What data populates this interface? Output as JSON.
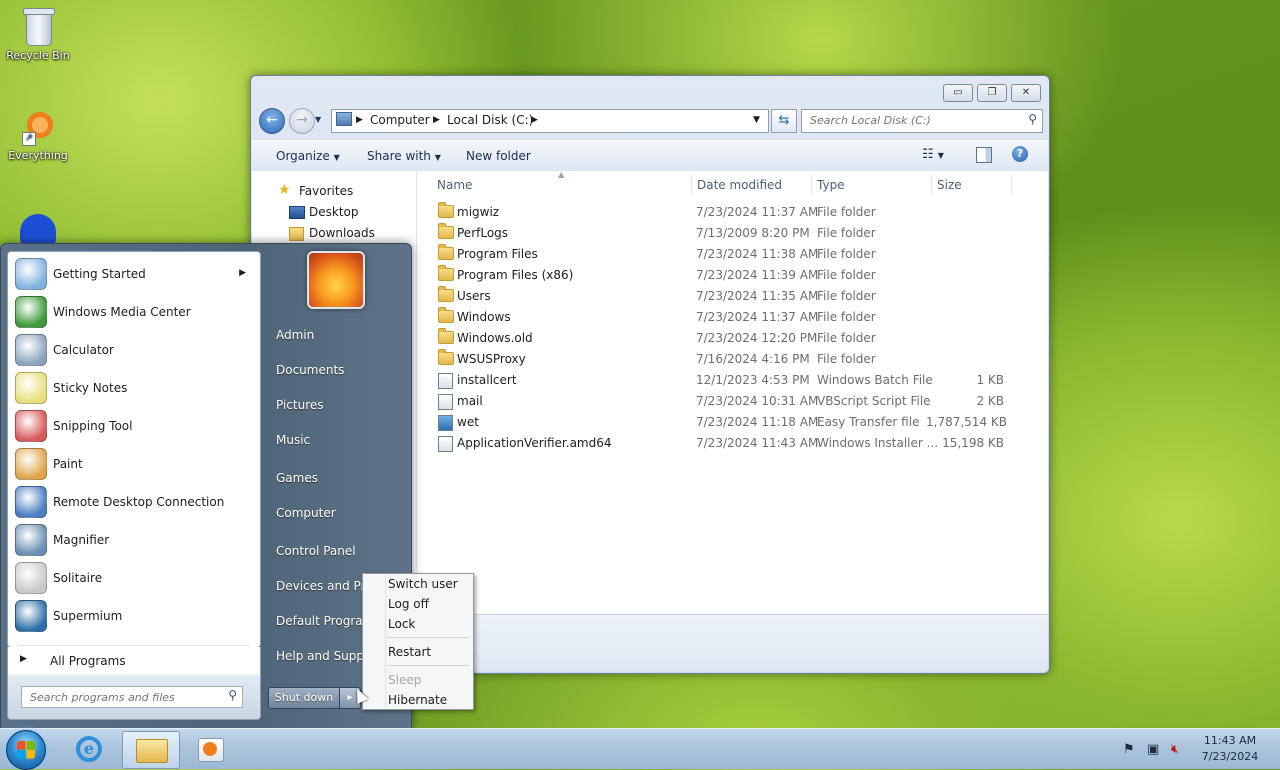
{
  "desktop": {
    "icons": [
      {
        "label": "Recycle Bin",
        "icon": "recycle-bin-icon"
      },
      {
        "label": "Everything",
        "icon": "everything-icon"
      },
      {
        "label": "",
        "icon": "malwarebytes-icon"
      }
    ]
  },
  "explorer": {
    "caption_buttons": {
      "minimize": "▭",
      "maximize": "❐",
      "close": "✕"
    },
    "breadcrumb": [
      "Computer",
      "Local Disk (C:)"
    ],
    "search_placeholder": "Search Local Disk (C:)",
    "toolbar": {
      "organize": "Organize",
      "share_with": "Share with",
      "new_folder": "New folder"
    },
    "nav_pane": {
      "favorites": "Favorites",
      "items": [
        "Desktop",
        "Downloads"
      ]
    },
    "columns": {
      "name": "Name",
      "date": "Date modified",
      "type": "Type",
      "size": "Size"
    },
    "files": [
      {
        "name": "migwiz",
        "date": "7/23/2024 11:37 AM",
        "type": "File folder",
        "size": "",
        "icon": "folder-icon"
      },
      {
        "name": "PerfLogs",
        "date": "7/13/2009 8:20 PM",
        "type": "File folder",
        "size": "",
        "icon": "folder-icon"
      },
      {
        "name": "Program Files",
        "date": "7/23/2024 11:38 AM",
        "type": "File folder",
        "size": "",
        "icon": "folder-icon"
      },
      {
        "name": "Program Files (x86)",
        "date": "7/23/2024 11:39 AM",
        "type": "File folder",
        "size": "",
        "icon": "folder-icon"
      },
      {
        "name": "Users",
        "date": "7/23/2024 11:35 AM",
        "type": "File folder",
        "size": "",
        "icon": "folder-icon"
      },
      {
        "name": "Windows",
        "date": "7/23/2024 11:37 AM",
        "type": "File folder",
        "size": "",
        "icon": "folder-icon"
      },
      {
        "name": "Windows.old",
        "date": "7/23/2024 12:20 PM",
        "type": "File folder",
        "size": "",
        "icon": "folder-icon"
      },
      {
        "name": "WSUSProxy",
        "date": "7/16/2024 4:16 PM",
        "type": "File folder",
        "size": "",
        "icon": "folder-icon"
      },
      {
        "name": "installcert",
        "date": "12/1/2023 4:53 PM",
        "type": "Windows Batch File",
        "size": "1 KB",
        "icon": "batch-file-icon"
      },
      {
        "name": "mail",
        "date": "7/23/2024 10:31 AM",
        "type": "VBScript Script File",
        "size": "2 KB",
        "icon": "script-file-icon"
      },
      {
        "name": "wet",
        "date": "7/23/2024 11:18 AM",
        "type": "Easy Transfer file",
        "size": "1,787,514 KB",
        "icon": "easy-transfer-icon"
      },
      {
        "name": "ApplicationVerifier.amd64",
        "date": "7/23/2024 11:43 AM",
        "type": "Windows Installer ...",
        "size": "15,198 KB",
        "icon": "installer-icon"
      }
    ]
  },
  "start_menu": {
    "programs": [
      {
        "label": "Getting Started",
        "icon": "getting-started-icon",
        "color": "#7fb3e0"
      },
      {
        "label": "Windows Media Center",
        "icon": "media-center-icon",
        "color": "#3d9b3a"
      },
      {
        "label": "Calculator",
        "icon": "calculator-icon",
        "color": "#8aa4bf"
      },
      {
        "label": "Sticky Notes",
        "icon": "sticky-notes-icon",
        "color": "#e8e07a"
      },
      {
        "label": "Snipping Tool",
        "icon": "snipping-tool-icon",
        "color": "#d65a5a"
      },
      {
        "label": "Paint",
        "icon": "paint-icon",
        "color": "#e0a64a"
      },
      {
        "label": "Remote Desktop Connection",
        "icon": "remote-desktop-icon",
        "color": "#4a7fc1"
      },
      {
        "label": "Magnifier",
        "icon": "magnifier-icon",
        "color": "#6c8fb3"
      },
      {
        "label": "Solitaire",
        "icon": "solitaire-icon",
        "color": "#c9c9c9"
      },
      {
        "label": "Supermium",
        "icon": "supermium-icon",
        "color": "#2f6fa8"
      }
    ],
    "all_programs": "All Programs",
    "search_placeholder": "Search programs and files",
    "right_items": [
      "Admin",
      "Documents",
      "Pictures",
      "Music",
      "Games",
      "Computer",
      "Control Panel",
      "Devices and Printers",
      "Default Programs",
      "Help and Support"
    ],
    "shutdown_label": "Shut down",
    "shutdown_arrow": "▸"
  },
  "shutdown_menu": {
    "group1": [
      "Switch user",
      "Log off",
      "Lock"
    ],
    "group2": [
      "Restart"
    ],
    "sleep": "Sleep",
    "hibernate": "Hibernate"
  },
  "taskbar": {
    "time": "11:43 AM",
    "date": "7/23/2024",
    "tray_icons": [
      "action-center-flag-icon",
      "network-icon",
      "volume-muted-icon"
    ]
  }
}
